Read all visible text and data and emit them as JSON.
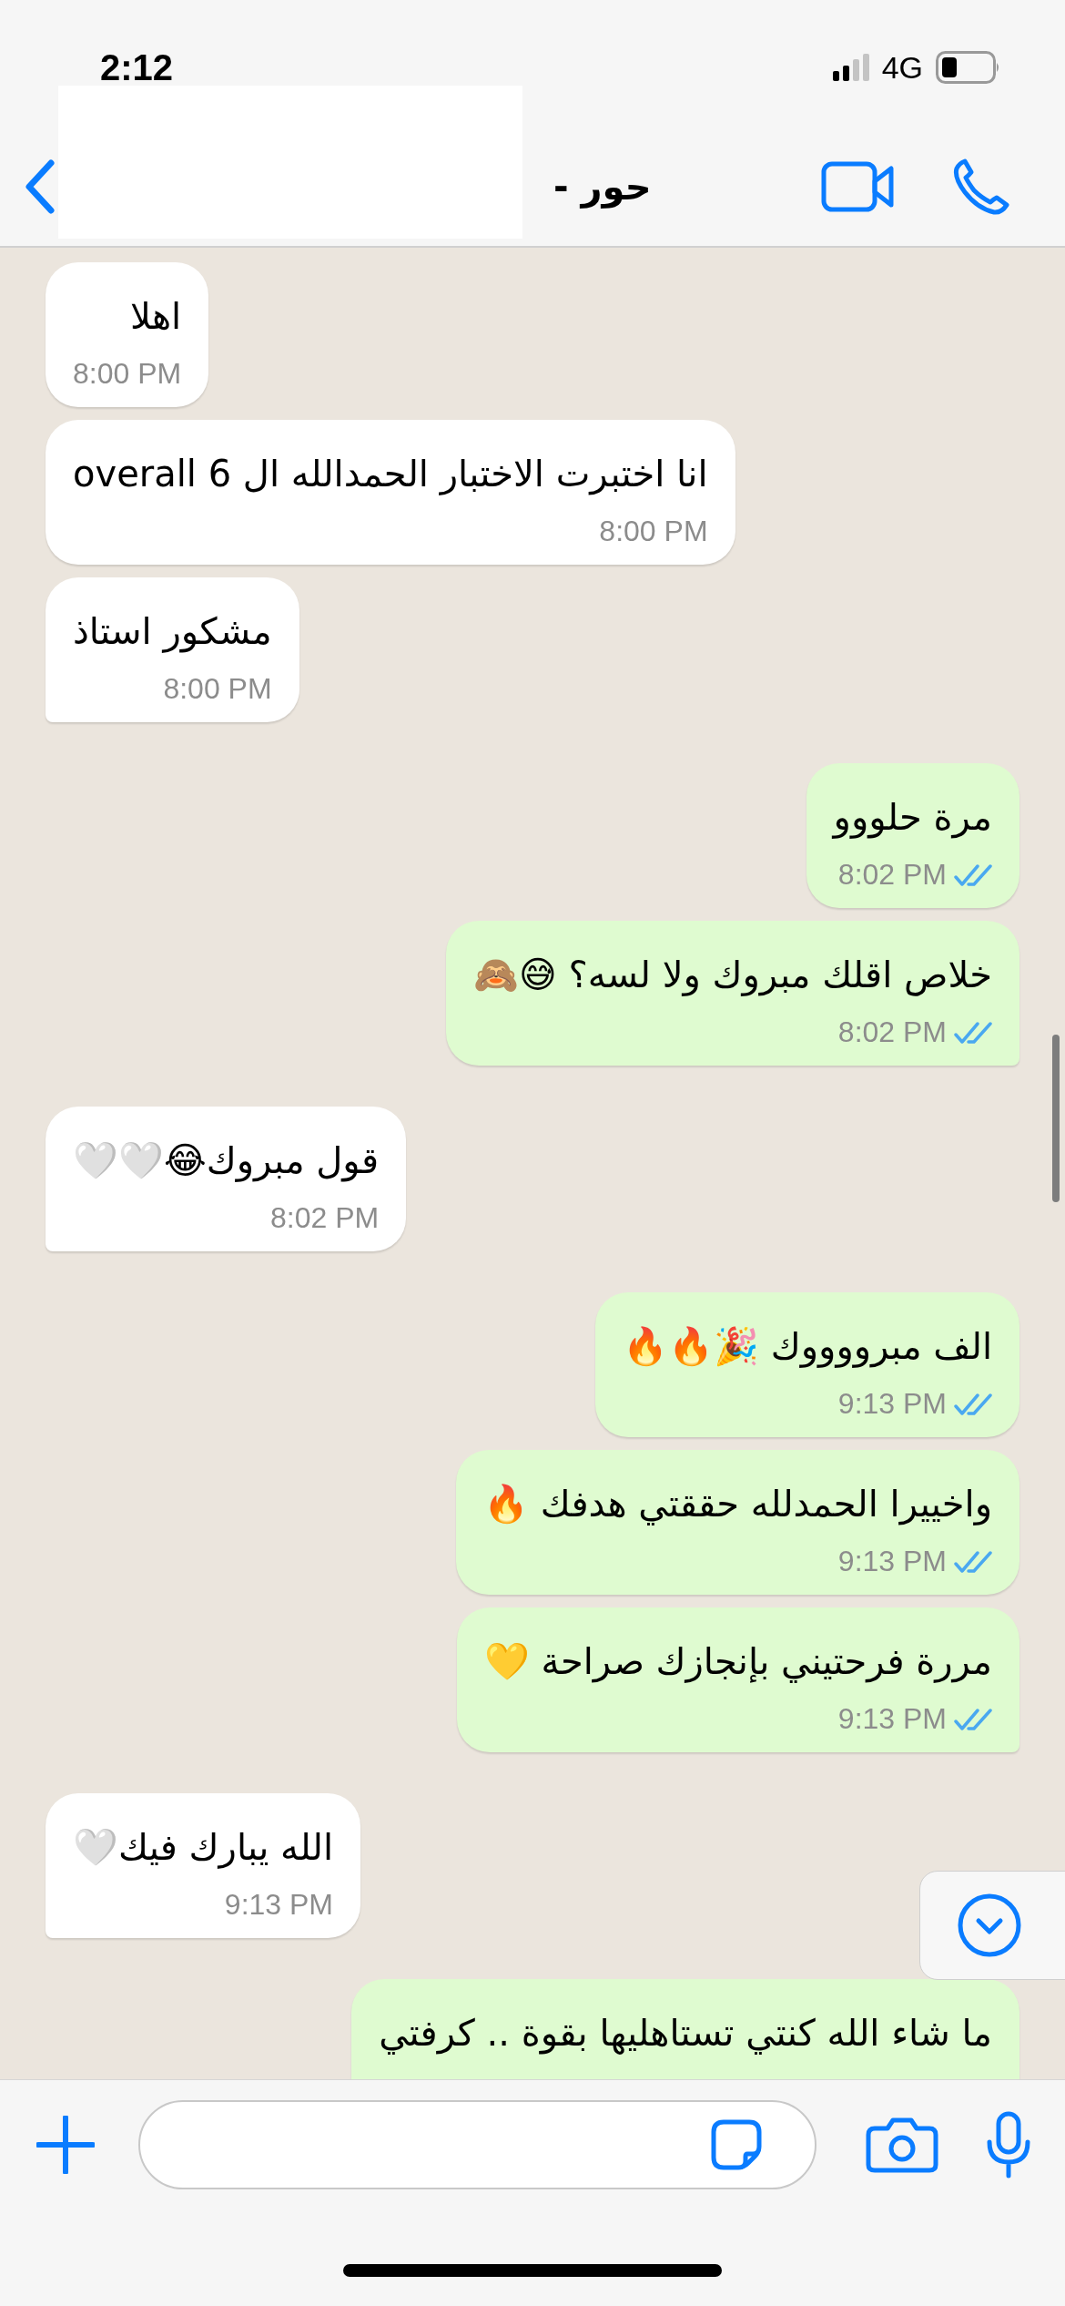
{
  "status_bar": {
    "time": "2:12",
    "network": "4G"
  },
  "header": {
    "title": "حور -"
  },
  "messages": [
    {
      "kind": "incoming",
      "text": "اهلا",
      "time": "8:00 PM"
    },
    {
      "kind": "incoming",
      "text": "انا اختبرت الاختبار الحمدالله ال 6 overall",
      "time": "8:00 PM"
    },
    {
      "kind": "incoming",
      "text": "مشكور استاذ",
      "time": "8:00 PM"
    },
    {
      "kind": "outgoing",
      "text": "مرة حلووو",
      "time": "8:02 PM",
      "read": true
    },
    {
      "kind": "outgoing",
      "text": "خلاص اقلك مبروك ولا لسه؟ 😅🙈",
      "time": "8:02 PM",
      "read": true
    },
    {
      "kind": "incoming",
      "text": "قول مبروك😂🤍🤍",
      "time": "8:02 PM"
    },
    {
      "kind": "outgoing",
      "text": "الف مبرووووك 🎉🔥🔥",
      "time": "9:13 PM",
      "read": true
    },
    {
      "kind": "outgoing",
      "text": "واخييرا الحمدلله حققتي هدفك 🔥",
      "time": "9:13 PM",
      "read": true
    },
    {
      "kind": "outgoing",
      "text": "مررة فرحتيني بإنجازك صراحة 💛",
      "time": "9:13 PM",
      "read": true
    },
    {
      "kind": "incoming",
      "text": "الله يبارك فيك🤍",
      "time": "9:13 PM"
    },
    {
      "kind": "outgoing",
      "text": "ما شاء الله كنتي تستاهليها بقوة .. كرفتي"
    }
  ]
}
